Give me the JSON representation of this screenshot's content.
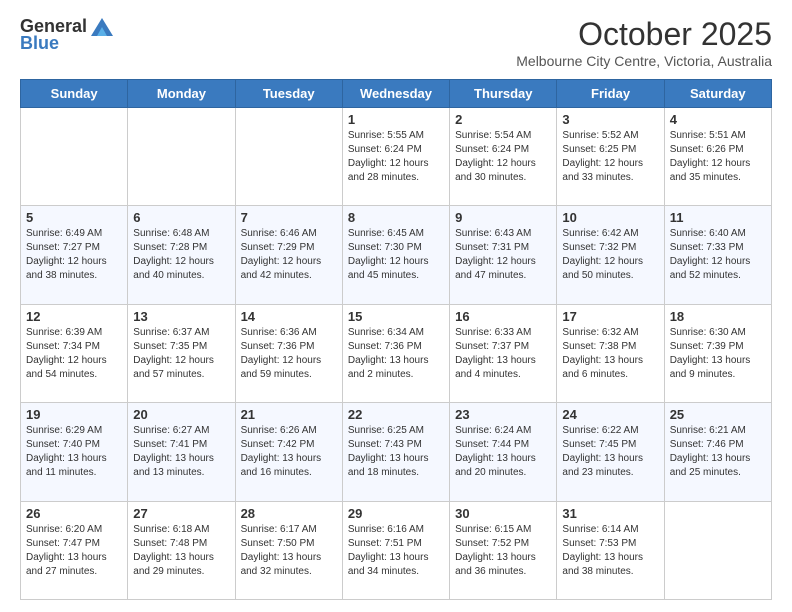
{
  "logo": {
    "general": "General",
    "blue": "Blue"
  },
  "header": {
    "month": "October 2025",
    "location": "Melbourne City Centre, Victoria, Australia"
  },
  "weekdays": [
    "Sunday",
    "Monday",
    "Tuesday",
    "Wednesday",
    "Thursday",
    "Friday",
    "Saturday"
  ],
  "weeks": [
    [
      {
        "day": "",
        "info": ""
      },
      {
        "day": "",
        "info": ""
      },
      {
        "day": "",
        "info": ""
      },
      {
        "day": "1",
        "info": "Sunrise: 5:55 AM\nSunset: 6:24 PM\nDaylight: 12 hours\nand 28 minutes."
      },
      {
        "day": "2",
        "info": "Sunrise: 5:54 AM\nSunset: 6:24 PM\nDaylight: 12 hours\nand 30 minutes."
      },
      {
        "day": "3",
        "info": "Sunrise: 5:52 AM\nSunset: 6:25 PM\nDaylight: 12 hours\nand 33 minutes."
      },
      {
        "day": "4",
        "info": "Sunrise: 5:51 AM\nSunset: 6:26 PM\nDaylight: 12 hours\nand 35 minutes."
      }
    ],
    [
      {
        "day": "5",
        "info": "Sunrise: 6:49 AM\nSunset: 7:27 PM\nDaylight: 12 hours\nand 38 minutes."
      },
      {
        "day": "6",
        "info": "Sunrise: 6:48 AM\nSunset: 7:28 PM\nDaylight: 12 hours\nand 40 minutes."
      },
      {
        "day": "7",
        "info": "Sunrise: 6:46 AM\nSunset: 7:29 PM\nDaylight: 12 hours\nand 42 minutes."
      },
      {
        "day": "8",
        "info": "Sunrise: 6:45 AM\nSunset: 7:30 PM\nDaylight: 12 hours\nand 45 minutes."
      },
      {
        "day": "9",
        "info": "Sunrise: 6:43 AM\nSunset: 7:31 PM\nDaylight: 12 hours\nand 47 minutes."
      },
      {
        "day": "10",
        "info": "Sunrise: 6:42 AM\nSunset: 7:32 PM\nDaylight: 12 hours\nand 50 minutes."
      },
      {
        "day": "11",
        "info": "Sunrise: 6:40 AM\nSunset: 7:33 PM\nDaylight: 12 hours\nand 52 minutes."
      }
    ],
    [
      {
        "day": "12",
        "info": "Sunrise: 6:39 AM\nSunset: 7:34 PM\nDaylight: 12 hours\nand 54 minutes."
      },
      {
        "day": "13",
        "info": "Sunrise: 6:37 AM\nSunset: 7:35 PM\nDaylight: 12 hours\nand 57 minutes."
      },
      {
        "day": "14",
        "info": "Sunrise: 6:36 AM\nSunset: 7:36 PM\nDaylight: 12 hours\nand 59 minutes."
      },
      {
        "day": "15",
        "info": "Sunrise: 6:34 AM\nSunset: 7:36 PM\nDaylight: 13 hours\nand 2 minutes."
      },
      {
        "day": "16",
        "info": "Sunrise: 6:33 AM\nSunset: 7:37 PM\nDaylight: 13 hours\nand 4 minutes."
      },
      {
        "day": "17",
        "info": "Sunrise: 6:32 AM\nSunset: 7:38 PM\nDaylight: 13 hours\nand 6 minutes."
      },
      {
        "day": "18",
        "info": "Sunrise: 6:30 AM\nSunset: 7:39 PM\nDaylight: 13 hours\nand 9 minutes."
      }
    ],
    [
      {
        "day": "19",
        "info": "Sunrise: 6:29 AM\nSunset: 7:40 PM\nDaylight: 13 hours\nand 11 minutes."
      },
      {
        "day": "20",
        "info": "Sunrise: 6:27 AM\nSunset: 7:41 PM\nDaylight: 13 hours\nand 13 minutes."
      },
      {
        "day": "21",
        "info": "Sunrise: 6:26 AM\nSunset: 7:42 PM\nDaylight: 13 hours\nand 16 minutes."
      },
      {
        "day": "22",
        "info": "Sunrise: 6:25 AM\nSunset: 7:43 PM\nDaylight: 13 hours\nand 18 minutes."
      },
      {
        "day": "23",
        "info": "Sunrise: 6:24 AM\nSunset: 7:44 PM\nDaylight: 13 hours\nand 20 minutes."
      },
      {
        "day": "24",
        "info": "Sunrise: 6:22 AM\nSunset: 7:45 PM\nDaylight: 13 hours\nand 23 minutes."
      },
      {
        "day": "25",
        "info": "Sunrise: 6:21 AM\nSunset: 7:46 PM\nDaylight: 13 hours\nand 25 minutes."
      }
    ],
    [
      {
        "day": "26",
        "info": "Sunrise: 6:20 AM\nSunset: 7:47 PM\nDaylight: 13 hours\nand 27 minutes."
      },
      {
        "day": "27",
        "info": "Sunrise: 6:18 AM\nSunset: 7:48 PM\nDaylight: 13 hours\nand 29 minutes."
      },
      {
        "day": "28",
        "info": "Sunrise: 6:17 AM\nSunset: 7:50 PM\nDaylight: 13 hours\nand 32 minutes."
      },
      {
        "day": "29",
        "info": "Sunrise: 6:16 AM\nSunset: 7:51 PM\nDaylight: 13 hours\nand 34 minutes."
      },
      {
        "day": "30",
        "info": "Sunrise: 6:15 AM\nSunset: 7:52 PM\nDaylight: 13 hours\nand 36 minutes."
      },
      {
        "day": "31",
        "info": "Sunrise: 6:14 AM\nSunset: 7:53 PM\nDaylight: 13 hours\nand 38 minutes."
      },
      {
        "day": "",
        "info": ""
      }
    ]
  ]
}
